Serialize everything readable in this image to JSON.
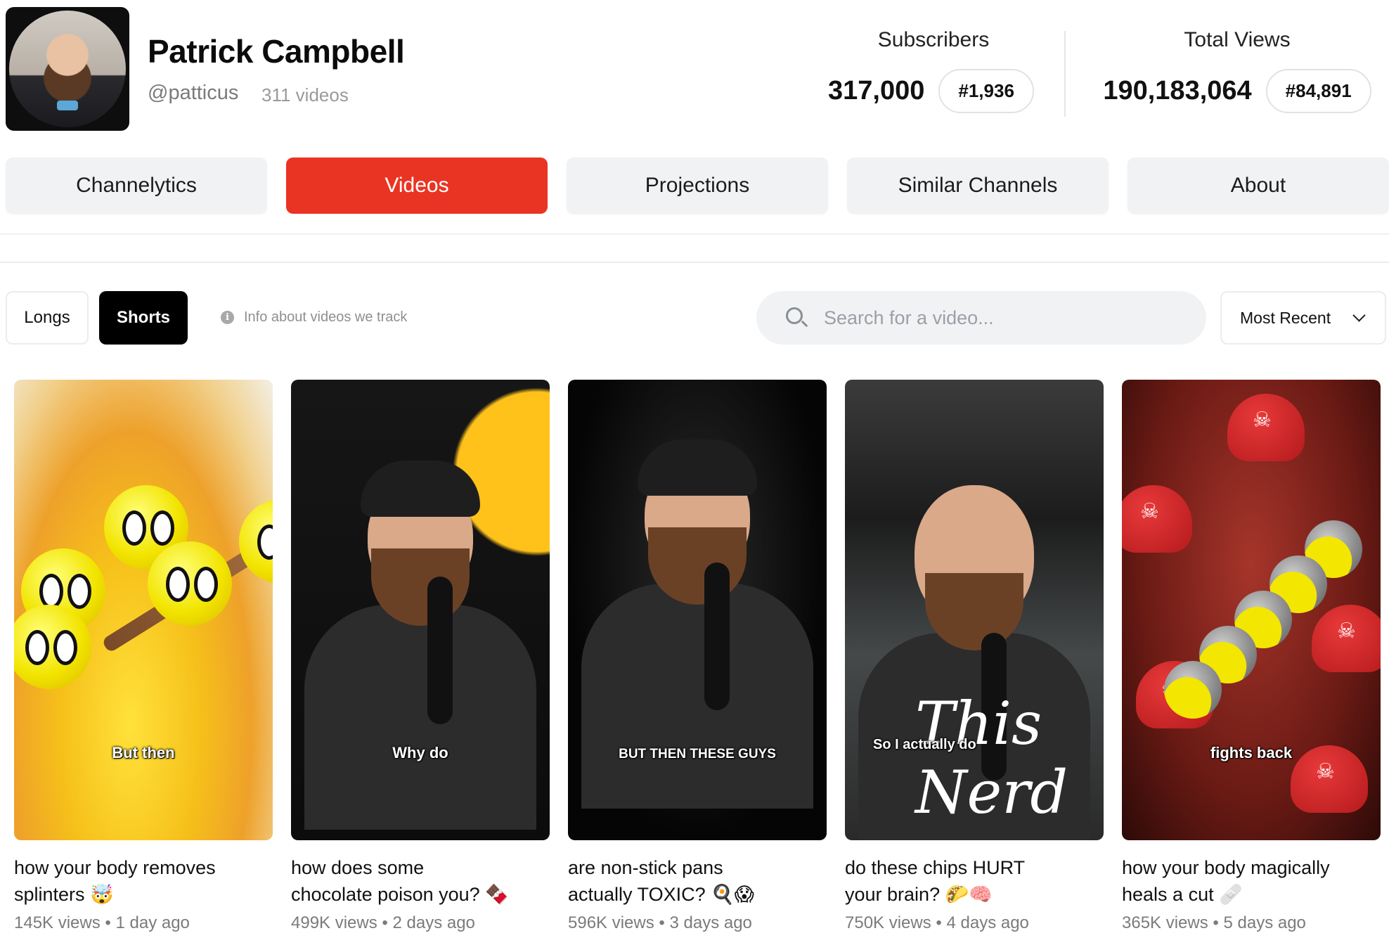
{
  "channel": {
    "name": "Patrick Campbell",
    "handle": "@patticus",
    "video_count": "311 videos"
  },
  "stats": {
    "subscribers": {
      "label": "Subscribers",
      "value": "317,000",
      "rank": "#1,936"
    },
    "total_views": {
      "label": "Total Views",
      "value": "190,183,064",
      "rank": "#84,891"
    }
  },
  "nav": {
    "tabs": [
      {
        "label": "Channelytics",
        "active": false
      },
      {
        "label": "Videos",
        "active": true
      },
      {
        "label": "Projections",
        "active": false
      },
      {
        "label": "Similar Channels",
        "active": false
      },
      {
        "label": "About",
        "active": false
      }
    ],
    "accent": "#ea3423"
  },
  "filters": {
    "longs_label": "Longs",
    "shorts_label": "Shorts",
    "selected": "Shorts",
    "info_text": "Info about videos we track",
    "search_placeholder": "Search for a video...",
    "sort_value": "Most Recent"
  },
  "videos": [
    {
      "title_line1": "how your body removes",
      "title_line2": "splinters 🤯",
      "views": "145K views",
      "age": "1 day ago",
      "caption": "But then"
    },
    {
      "title_line1": "how does some",
      "title_line2": "chocolate poison you? 🍫",
      "views": "499K views",
      "age": "2 days ago",
      "caption": "Why do"
    },
    {
      "title_line1": "are non-stick pans",
      "title_line2": "actually TOXIC? 🍳😱",
      "views": "596K views",
      "age": "3 days ago",
      "caption": "BUT THEN THESE GUYS"
    },
    {
      "title_line1": "do these chips HURT",
      "title_line2": "your brain? 🌮🧠",
      "views": "750K views",
      "age": "4 days ago",
      "caption": "So I actually do",
      "overlay": "This Nerd"
    },
    {
      "title_line1": "how your body magically",
      "title_line2": "heals a cut 🩹",
      "views": "365K views",
      "age": "5 days ago",
      "caption": "fights back"
    }
  ]
}
